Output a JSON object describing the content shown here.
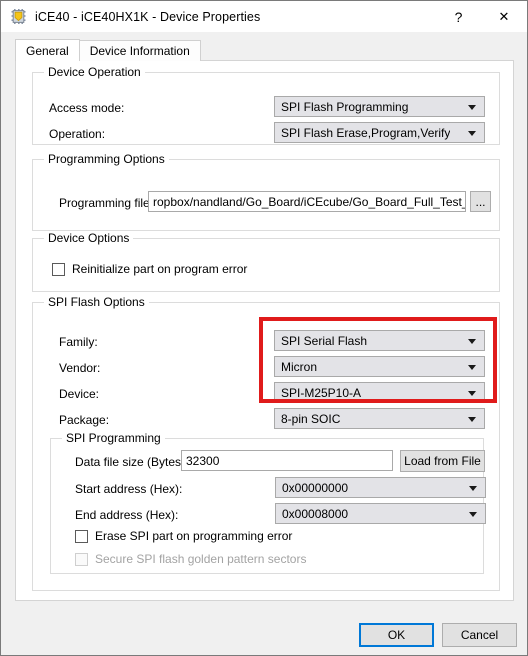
{
  "window": {
    "title": "iCE40 - iCE40HX1K - Device Properties",
    "icon": "chip-icon",
    "help_label": "?",
    "close_label": "✕"
  },
  "tabs": [
    {
      "label": "General",
      "active": true
    },
    {
      "label": "Device Information",
      "active": false
    }
  ],
  "groups": {
    "device_operation": {
      "title": "Device Operation",
      "fields": [
        {
          "label": "Access mode:",
          "value": "SPI Flash Programming"
        },
        {
          "label": "Operation:",
          "value": "SPI Flash Erase,Program,Verify"
        }
      ]
    },
    "programming_options": {
      "title": "Programming Options",
      "file_label": "Programming file:",
      "file_value": "ropbox/nandland/Go_Board/iCEcube/Go_Board_Full_Test_bitmap.bin",
      "browse_label": "..."
    },
    "device_options": {
      "title": "Device Options",
      "reinitialize_label": "Reinitialize part on program error",
      "reinitialize_checked": false
    },
    "spi_flash_options": {
      "title": "SPI Flash Options",
      "fields": [
        {
          "label": "Family:",
          "value": "SPI Serial Flash"
        },
        {
          "label": "Vendor:",
          "value": "Micron"
        },
        {
          "label": "Device:",
          "value": "SPI-M25P10-A"
        },
        {
          "label": "Package:",
          "value": "8-pin SOIC"
        }
      ],
      "highlight_color": "#e01b1b"
    },
    "spi_programming": {
      "title": "SPI Programming",
      "data_file_size_label": "Data file size (Bytes):",
      "data_file_size_value": "32300",
      "load_from_file_label": "Load from File",
      "start_address_label": "Start address (Hex):",
      "start_address_value": "0x00000000",
      "end_address_label": "End address (Hex):",
      "end_address_value": "0x00008000",
      "erase_label": "Erase SPI part on programming error",
      "erase_checked": false,
      "secure_label": "Secure SPI flash golden pattern sectors",
      "secure_checked": false,
      "secure_disabled": true
    }
  },
  "footer": {
    "ok_label": "OK",
    "cancel_label": "Cancel"
  }
}
